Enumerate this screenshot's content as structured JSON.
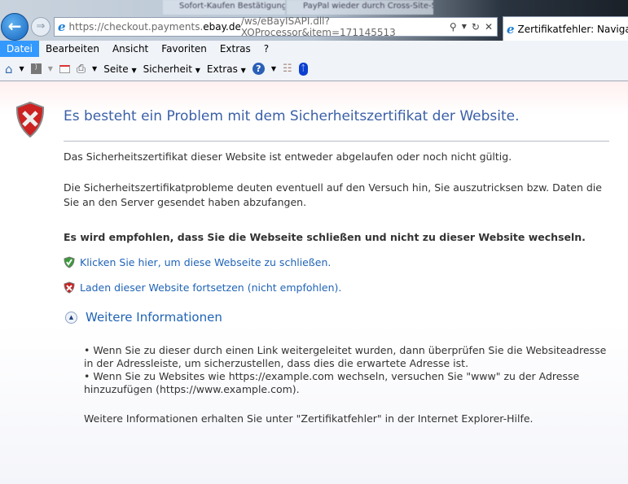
{
  "browser": {
    "background_tabs": [
      "Sofort-Kaufen Bestätigung",
      "PayPal wieder durch Cross-Site-Scrip..."
    ],
    "address": {
      "prefix": "https://checkout.payments.",
      "domain": "ebay.de",
      "suffix": "/ws/eBayISAPI.dll?XOProcessor&item=171145513"
    },
    "active_tab": "Zertifikatfehler: Navigatio",
    "menu": [
      "Datei",
      "Bearbeiten",
      "Ansicht",
      "Favoriten",
      "Extras",
      "?"
    ],
    "commands": {
      "page": "Seite",
      "security": "Sicherheit",
      "tools": "Extras"
    }
  },
  "page": {
    "title": "Es besteht ein Problem mit dem Sicherheitszertifikat der Website.",
    "p1": "Das Sicherheitszertifikat dieser Website ist entweder abgelaufen oder noch nicht gültig.",
    "p2": "Die Sicherheitszertifikatprobleme deuten eventuell auf den Versuch hin, Sie auszutricksen bzw. Daten die Sie an den Server gesendet haben abzufangen.",
    "recommend": "Es wird empfohlen, dass Sie die Webseite schließen und nicht zu dieser Website wechseln.",
    "close_link": "Klicken Sie hier, um diese Webseite zu schließen.",
    "continue_link": "Laden dieser Website fortsetzen (nicht empfohlen).",
    "more_info": "Weitere Informationen",
    "bullets": [
      "Wenn Sie zu dieser durch einen Link weitergeleitet wurden, dann überprüfen Sie die Websiteadresse in der Adressleiste, um sicherzustellen, dass dies die erwartete Adresse ist.",
      "Wenn Sie zu Websites wie https://example.com wechseln, versuchen Sie \"www\" zu der Adresse hinzuzufügen (https://www.example.com)."
    ],
    "footer": "Weitere Informationen erhalten Sie unter \"Zertifikatfehler\" in der Internet Explorer-Hilfe."
  },
  "colors": {
    "title": "#3a5fa8",
    "link": "#1f63b6",
    "menu_selected": "#3399ff"
  }
}
